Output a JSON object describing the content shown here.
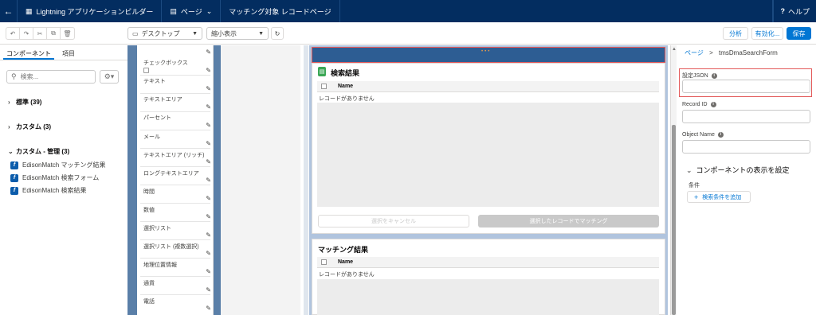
{
  "header": {
    "app_title": "Lightning アプリケーションビルダー",
    "pages_menu": "ページ",
    "page_name": "マッチング対象 レコードページ",
    "help": "ヘルプ"
  },
  "toolbar": {
    "device": "デスクトップ",
    "view_mode": "縮小表示",
    "analyze": "分析",
    "activate": "有効化...",
    "save": "保存"
  },
  "left_panel": {
    "tabs": [
      "コンポーネント",
      "項目"
    ],
    "search_placeholder": "検索...",
    "categories": [
      {
        "label": "標準 (39)"
      },
      {
        "label": "カスタム (3)"
      },
      {
        "label": "カスタム - 管理 (3)"
      }
    ],
    "managed_components": [
      "EdisonMatch マッチング結果",
      "EdisonMatch 検索フォーム",
      "EdisonMatch 検索結果"
    ]
  },
  "fields": [
    "チェックボックス",
    "テキスト",
    "テキストエリア",
    "パーセント",
    "メール",
    "テキストエリア (リッチ)",
    "ロングテキストエリア",
    "時間",
    "数値",
    "選択リスト",
    "選択リスト (複数選択)",
    "地理位置情報",
    "通貨",
    "電話"
  ],
  "canvas": {
    "search_results_title": "検索結果",
    "column_name": "Name",
    "no_records": "レコードがありません",
    "cancel_selection": "選択をキャンセル",
    "match_selected": "選択したレコードでマッチング",
    "matching_results_title": "マッチング結果"
  },
  "right_panel": {
    "breadcrumb_link": "ページ",
    "breadcrumb_sep": ">",
    "breadcrumb_current": "tmsDmaSearchForm",
    "setting_json_label": "設定JSON",
    "record_id_label": "Record ID",
    "object_name_label": "Object Name",
    "visibility_section": "コンポーネントの表示を設定",
    "condition_label": "条件",
    "add_condition": "検索条件を追加"
  },
  "colors": {
    "header_bg": "#032d60",
    "brand_blue": "#0176d3",
    "highlight_red": "#e35a5a"
  }
}
